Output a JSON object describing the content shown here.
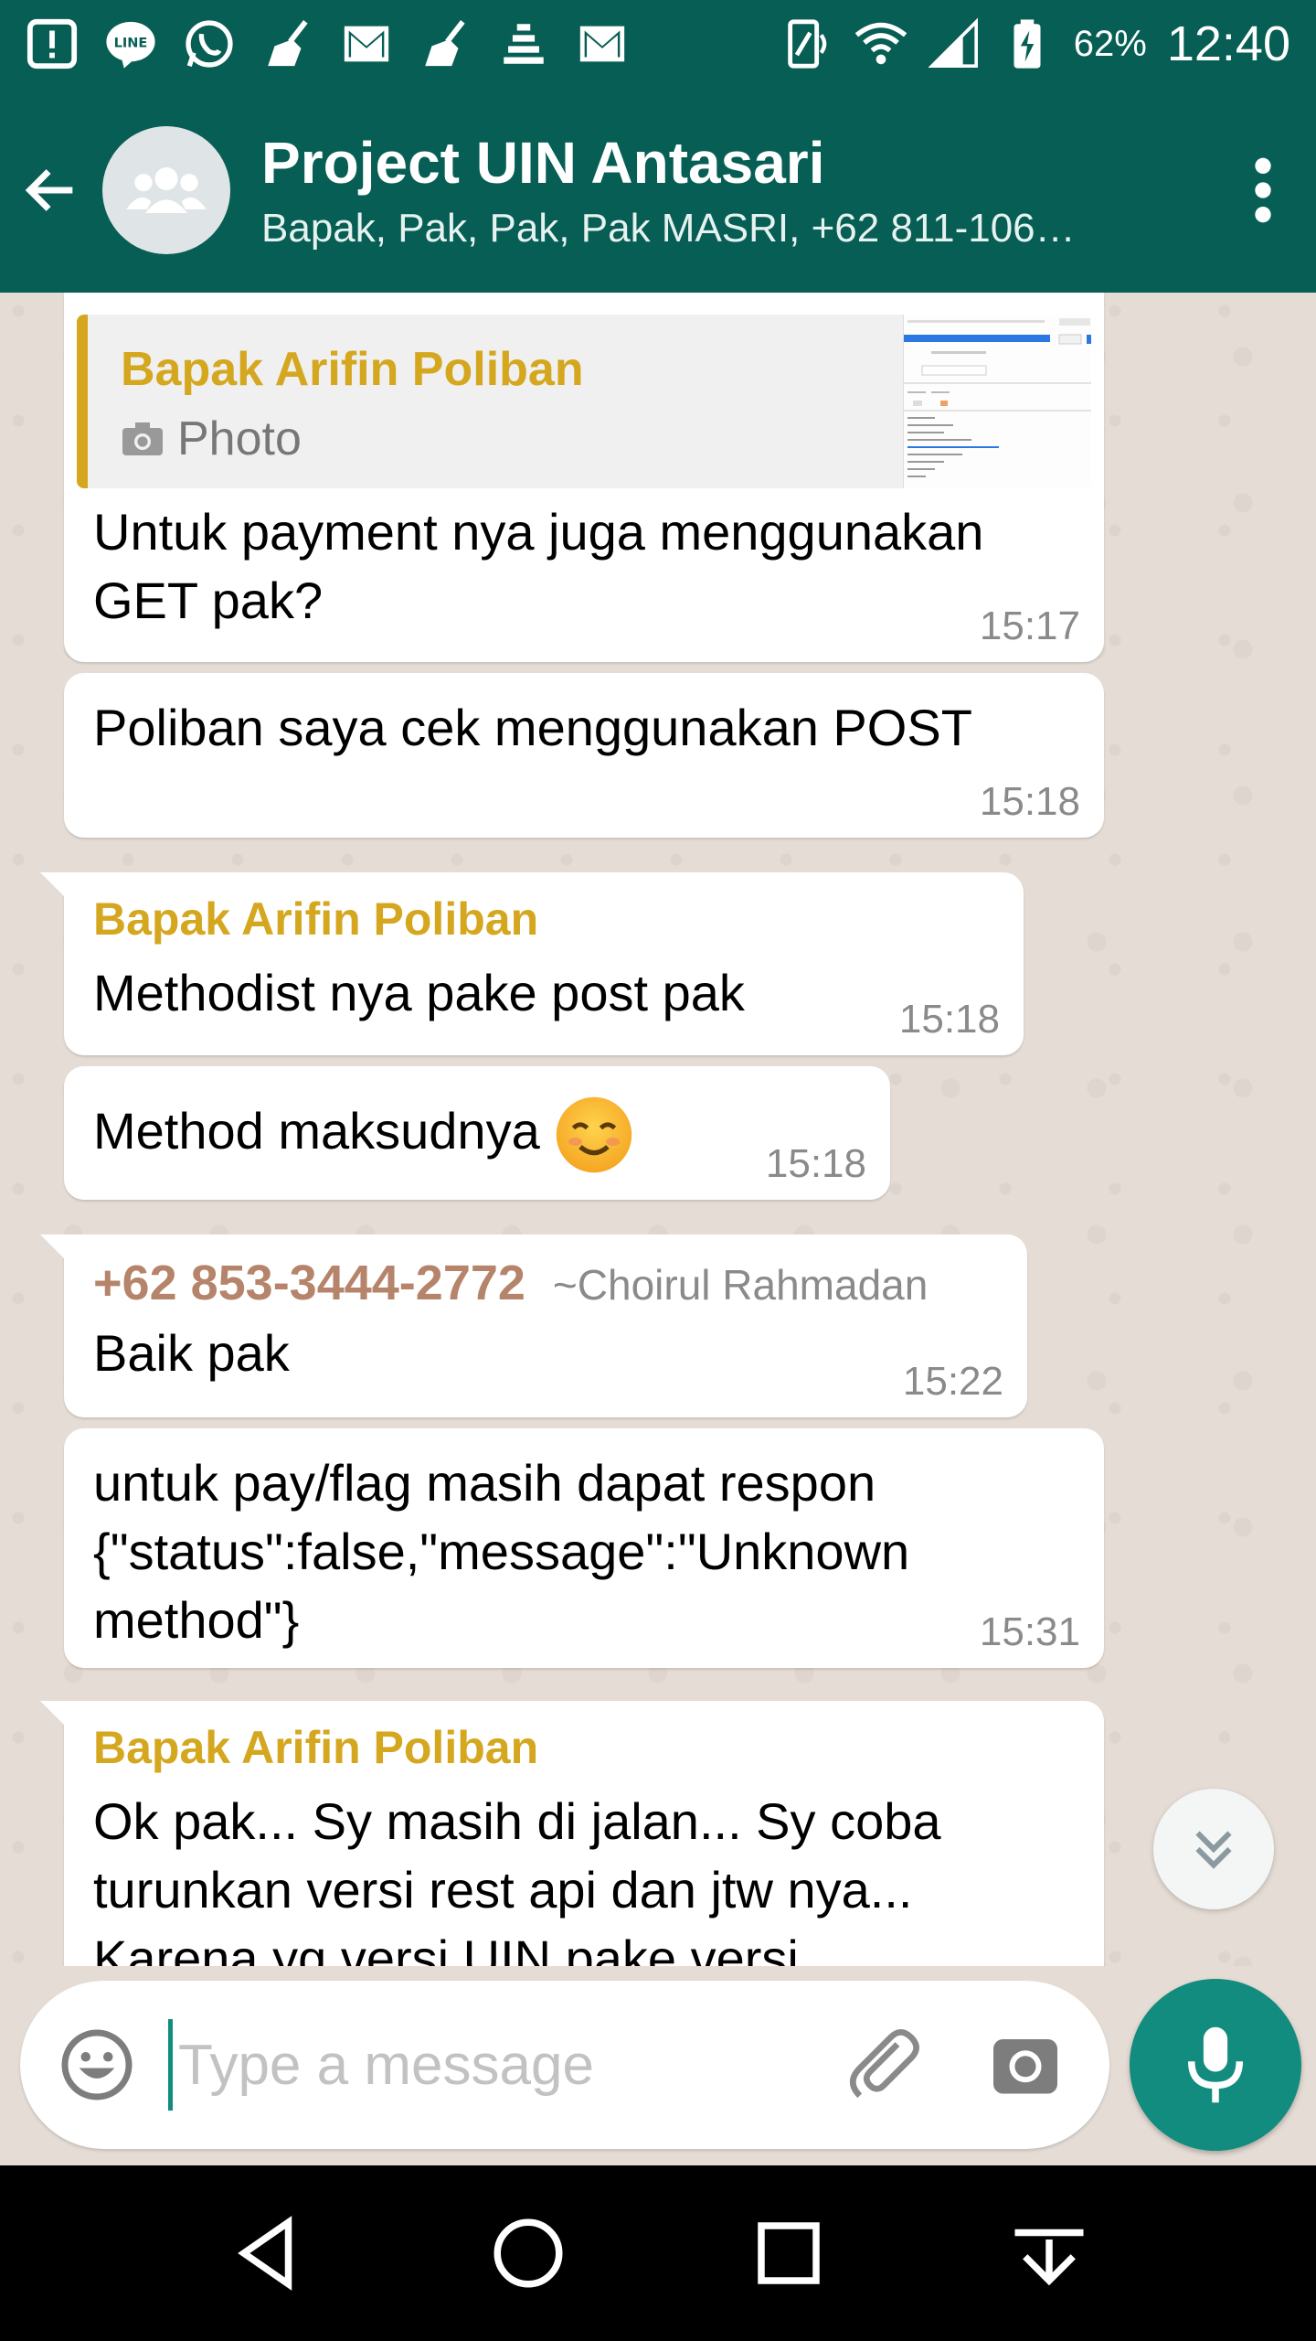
{
  "status_bar": {
    "battery_pct": "62%",
    "time": "12:40",
    "icons": [
      "alert-icon",
      "line-icon",
      "whatsapp-icon",
      "broom-icon",
      "gmail-icon",
      "broom-icon",
      "signal-bars-icon",
      "gmail-icon",
      "nfc-icon",
      "wifi-icon",
      "cell-signal-icon",
      "battery-charging-icon"
    ]
  },
  "header": {
    "title": "Project UIN Antasari",
    "subtitle": "Bapak, Pak, Pak, Pak MASRI, +62 811-106…"
  },
  "messages": [
    {
      "quote_sender": "Bapak Arifin Poliban",
      "quote_type": "Photo",
      "text": "Untuk payment nya juga menggunakan GET pak?",
      "time": "15:17"
    },
    {
      "text": "Poliban saya cek menggunakan POST",
      "time": "15:18"
    },
    {
      "sender": "Bapak Arifin Poliban",
      "text": "Methodist nya pake post pak",
      "time": "15:18"
    },
    {
      "text": "Method maksudnya",
      "time": "15:18"
    },
    {
      "sender_phone": "+62 853-3444-2772",
      "sender_alias": "~Choirul Rahmadan",
      "text": "Baik pak",
      "time": "15:22"
    },
    {
      "text": "untuk pay/flag masih dapat respon {\"status\":false,\"message\":\"Unknown method\"}",
      "time": "15:31"
    },
    {
      "sender": "Bapak Arifin Poliban",
      "text": "Ok pak... Sy masih di jalan... Sy coba turunkan versi rest api dan jtw nya... Karena yg versi UIN pake versi"
    }
  ],
  "input": {
    "placeholder": "Type a message"
  },
  "colors": {
    "header_bg": "#075e54",
    "accent": "#128c7e",
    "chat_bg": "#e5ddd5",
    "sender_gold": "#d4a71f",
    "sender_brown": "#b5846a"
  }
}
